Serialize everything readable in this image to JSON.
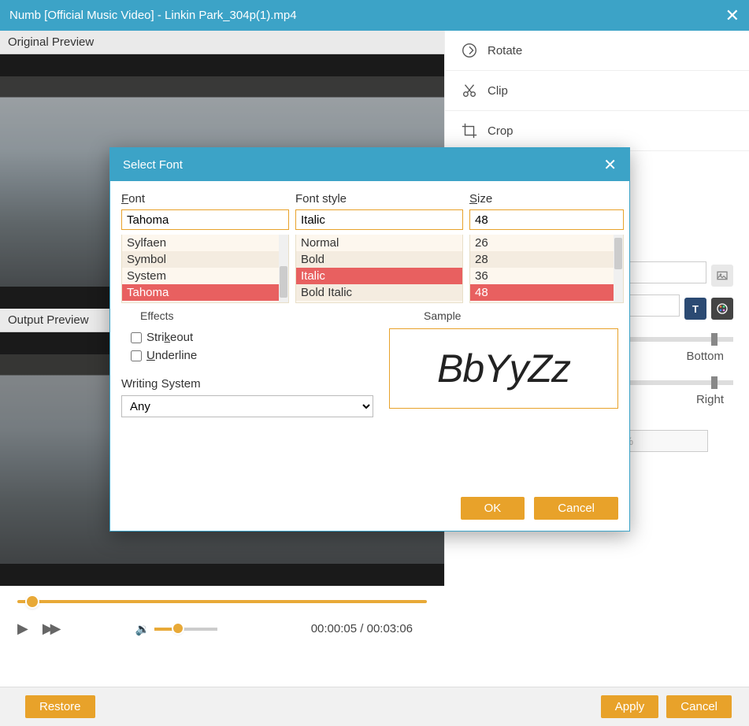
{
  "window": {
    "title": "Numb [Official Music Video] - Linkin Park_304p(1).mp4"
  },
  "labels": {
    "original_preview": "Original Preview",
    "output_preview": "Output Preview"
  },
  "tools": {
    "rotate": "Rotate",
    "clip": "Clip",
    "crop": "Crop"
  },
  "right_panel": {
    "pos1_label": "Bottom",
    "pos2_label": "Right",
    "opacity_value": "50%"
  },
  "player": {
    "current": "00:00:05",
    "total": "00:03:06"
  },
  "footer": {
    "restore": "Restore",
    "apply": "Apply",
    "cancel": "Cancel"
  },
  "dialog": {
    "title": "Select Font",
    "font_label": "Font",
    "style_label": "Font style",
    "size_label": "Size",
    "font_value": "Tahoma",
    "style_value": "Italic",
    "size_value": "48",
    "fonts": [
      "Sylfaen",
      "Symbol",
      "System",
      "Tahoma"
    ],
    "styles": [
      "Normal",
      "Bold",
      "Italic",
      "Bold Italic"
    ],
    "sizes": [
      "26",
      "28",
      "36",
      "48"
    ],
    "font_selected": "Tahoma",
    "style_selected": "Italic",
    "size_selected": "48",
    "effects_label": "Effects",
    "strikeout": "Strikeout",
    "underline": "Underline",
    "sample_label": "Sample",
    "sample_text": "BbYyZz",
    "writing_system_label": "Writing System",
    "writing_system_value": "Any",
    "ok": "OK",
    "cancel": "Cancel"
  }
}
